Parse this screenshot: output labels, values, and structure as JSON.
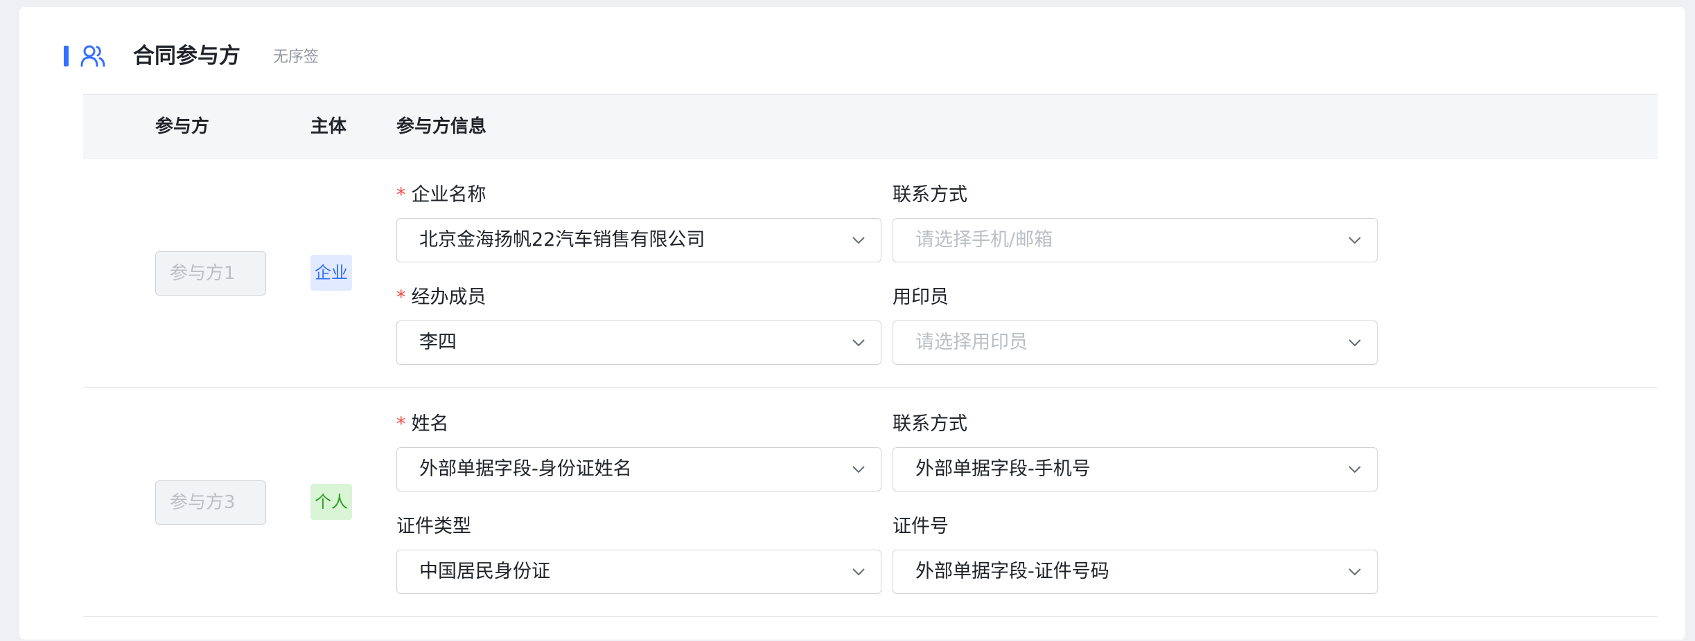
{
  "section": {
    "title": "合同参与方",
    "subtitle": "无序签",
    "accent_color": "#3370ff",
    "icon": "users-icon"
  },
  "table": {
    "headers": [
      "参与方",
      "主体",
      "参与方信息"
    ]
  },
  "parties": [
    {
      "name": "参与方1",
      "type": "企业",
      "fields": [
        {
          "label": "企业名称",
          "required": true,
          "value": "北京金海扬帆22汽车销售有限公司",
          "placeholder": ""
        },
        {
          "label": "联系方式",
          "required": false,
          "value": "",
          "placeholder": "请选择手机/邮箱"
        },
        {
          "label": "经办成员",
          "required": true,
          "value": "李四",
          "placeholder": ""
        },
        {
          "label": "用印员",
          "required": false,
          "value": "",
          "placeholder": "请选择用印员"
        }
      ]
    },
    {
      "name": "参与方3",
      "type": "个人",
      "fields": [
        {
          "label": "姓名",
          "required": true,
          "value": "外部单据字段-身份证姓名",
          "placeholder": ""
        },
        {
          "label": "联系方式",
          "required": false,
          "value": "外部单据字段-手机号",
          "placeholder": ""
        },
        {
          "label": "证件类型",
          "required": false,
          "value": "中国居民身份证",
          "placeholder": ""
        },
        {
          "label": "证件号",
          "required": false,
          "value": "外部单据字段-证件号码",
          "placeholder": ""
        }
      ]
    }
  ]
}
